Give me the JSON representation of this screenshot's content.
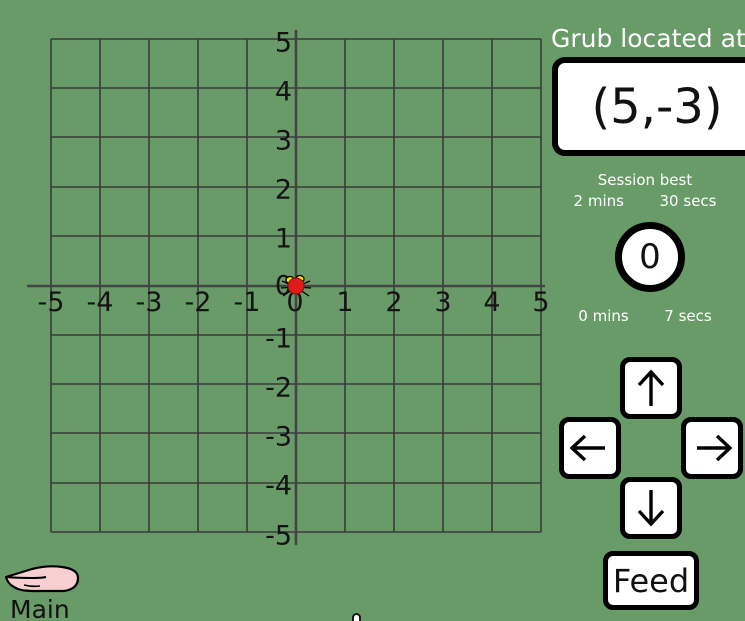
{
  "app": {
    "background_color": "#699b69",
    "grid_line_color": "#3a3a3a",
    "axis_color": "#3a3a3a"
  },
  "panel": {
    "title": "Grub located at",
    "coordinate_value": "(5,-3)",
    "session_best_label": "Session best",
    "session_best_mins": "2",
    "session_best_mins_unit": "mins",
    "session_best_secs": "30",
    "session_best_secs_unit": "secs",
    "timer_count": "0",
    "current_mins": "0",
    "current_mins_unit": "mins",
    "current_secs": "7",
    "current_secs_unit": "secs"
  },
  "controls": {
    "up_icon": "arrow-up-icon",
    "left_icon": "arrow-left-icon",
    "right_icon": "arrow-right-icon",
    "down_icon": "arrow-down-icon",
    "feed_label": "Feed"
  },
  "nav": {
    "main_label": "Main",
    "hand_icon": "pointing-hand-icon"
  },
  "grub": {
    "body_color": "#e01b1b",
    "spot_color": "#ffe000",
    "leg_color": "#000000",
    "position_x": 0,
    "position_y": 0
  },
  "chart_data": {
    "type": "scatter",
    "title": "",
    "xlabel": "",
    "ylabel": "",
    "xlim": [
      -5,
      5
    ],
    "ylim": [
      -5,
      5
    ],
    "grid": true,
    "legend": "none",
    "x_ticks": [
      "-5",
      "-4",
      "-3",
      "-2",
      "-1",
      "0",
      "1",
      "2",
      "3",
      "4",
      "5"
    ],
    "y_ticks": [
      "5",
      "4",
      "3",
      "2",
      "1",
      "0",
      "-1",
      "-2",
      "-3",
      "-4",
      "-5"
    ],
    "series": [
      {
        "name": "grub",
        "x": [
          0
        ],
        "y": [
          0
        ],
        "marker": "bug",
        "color": "#e01b1b"
      }
    ],
    "target_point": {
      "x": 5,
      "y": -3,
      "label": "(5,-3)"
    }
  }
}
